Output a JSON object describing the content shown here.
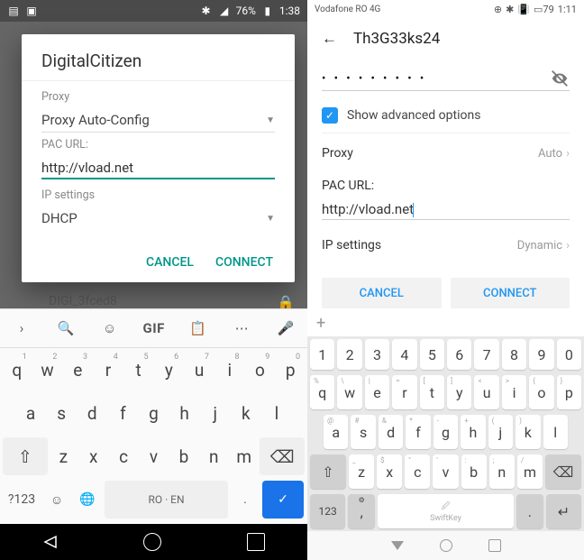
{
  "left": {
    "status": {
      "battery": "76%",
      "time": "1:38"
    },
    "dialog": {
      "title": "DigitalCitizen",
      "proxy_label": "Proxy",
      "proxy_value": "Proxy Auto-Config",
      "pac_label": "PAC URL:",
      "pac_value": "http://vload.net",
      "ip_label": "IP settings",
      "ip_value": "DHCP",
      "cancel": "CANCEL",
      "connect": "CONNECT"
    },
    "bg_network": "DIGI_3fced8",
    "keyboard": {
      "gif": "GIF",
      "row1": [
        [
          "q",
          "1"
        ],
        [
          "w",
          "2"
        ],
        [
          "e",
          "3"
        ],
        [
          "r",
          "4"
        ],
        [
          "t",
          "5"
        ],
        [
          "y",
          "6"
        ],
        [
          "u",
          "7"
        ],
        [
          "i",
          "8"
        ],
        [
          "o",
          "9"
        ],
        [
          "p",
          "0"
        ]
      ],
      "row2": [
        "a",
        "s",
        "d",
        "f",
        "g",
        "h",
        "j",
        "k",
        "l"
      ],
      "row3": [
        "z",
        "x",
        "c",
        "v",
        "b",
        "n",
        "m"
      ],
      "num": "?123",
      "space": "RO · EN",
      "dot": "."
    }
  },
  "right": {
    "status": {
      "carrier": "Vodafone RO",
      "net": "4G",
      "battery": "79",
      "time": "1:11"
    },
    "title": "Th3G33ks24",
    "password": "• • • • • • • • •",
    "show_adv": "Show advanced options",
    "proxy_label": "Proxy",
    "proxy_value": "Auto",
    "pac_label": "PAC URL:",
    "pac_value": "http://vload.net",
    "ip_label": "IP settings",
    "ip_value": "Dynamic",
    "cancel": "CANCEL",
    "connect": "CONNECT",
    "keyboard": {
      "nums": [
        "1",
        "2",
        "3",
        "4",
        "5",
        "6",
        "7",
        "8",
        "9",
        "0"
      ],
      "row1": [
        [
          "q",
          "%"
        ],
        [
          "w",
          "\\"
        ],
        [
          "e",
          "|"
        ],
        [
          "r",
          "="
        ],
        [
          "t",
          "["
        ],
        [
          "y",
          "]"
        ],
        [
          "u",
          "<"
        ],
        [
          "i",
          ">"
        ],
        [
          "o",
          "{"
        ],
        [
          "p",
          "}"
        ]
      ],
      "row2": [
        [
          "a",
          "@"
        ],
        [
          "s",
          "#"
        ],
        [
          "d",
          "&"
        ],
        [
          "f",
          "*"
        ],
        [
          "g",
          "-"
        ],
        [
          "h",
          "+"
        ],
        [
          "j",
          "("
        ],
        [
          "k",
          ")"
        ],
        [
          "l",
          ""
        ]
      ],
      "row3": [
        [
          "z",
          "_"
        ],
        [
          "x",
          "$"
        ],
        [
          "c",
          "\""
        ],
        [
          "v",
          "'"
        ],
        [
          "b",
          ":"
        ],
        [
          "n",
          ";"
        ],
        [
          "m",
          "/"
        ]
      ],
      "num": "123",
      "swift": "SwiftKey"
    }
  }
}
